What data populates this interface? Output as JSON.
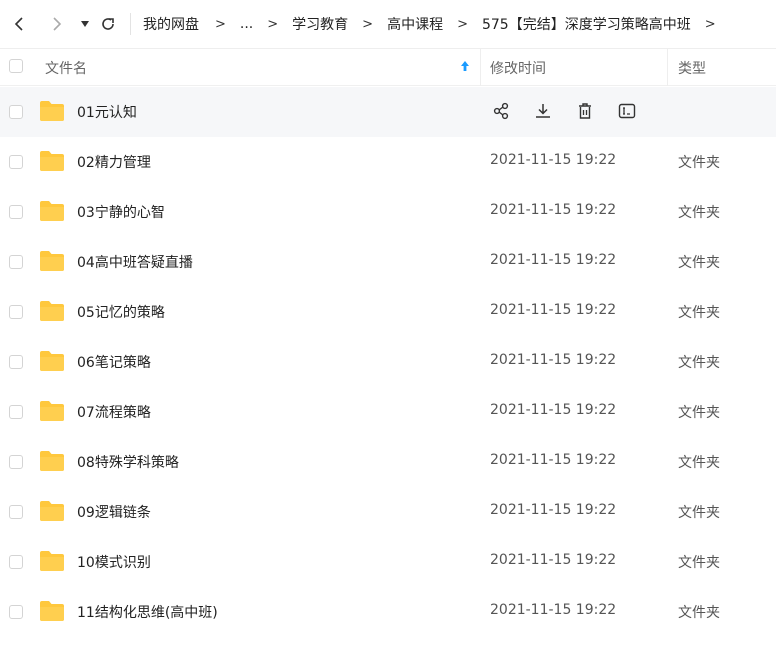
{
  "breadcrumb": [
    "我的网盘",
    "...",
    "学习教育",
    "高中课程",
    "575【完结】深度学习策略高中班"
  ],
  "header": {
    "name": "文件名",
    "modified": "修改时间",
    "type": "类型"
  },
  "rows": [
    {
      "name": "01元认知",
      "time": "",
      "type": ""
    },
    {
      "name": "02精力管理",
      "time": "2021-11-15 19:22",
      "type": "文件夹"
    },
    {
      "name": "03宁静的心智",
      "time": "2021-11-15 19:22",
      "type": "文件夹"
    },
    {
      "name": "04高中班答疑直播",
      "time": "2021-11-15 19:22",
      "type": "文件夹"
    },
    {
      "name": "05记忆的策略",
      "time": "2021-11-15 19:22",
      "type": "文件夹"
    },
    {
      "name": "06笔记策略",
      "time": "2021-11-15 19:22",
      "type": "文件夹"
    },
    {
      "name": "07流程策略",
      "time": "2021-11-15 19:22",
      "type": "文件夹"
    },
    {
      "name": "08特殊学科策略",
      "time": "2021-11-15 19:22",
      "type": "文件夹"
    },
    {
      "name": "09逻辑链条",
      "time": "2021-11-15 19:22",
      "type": "文件夹"
    },
    {
      "name": "10模式识别",
      "time": "2021-11-15 19:22",
      "type": "文件夹"
    },
    {
      "name": "11结构化思维(高中班)",
      "time": "2021-11-15 19:22",
      "type": "文件夹"
    }
  ],
  "colors": {
    "folder": "#ffc83d",
    "sort_arrow": "#1a9bff"
  },
  "icons": {
    "row_actions": [
      "share-icon",
      "download-icon",
      "delete-icon",
      "rename-icon"
    ],
    "nav": [
      "back-icon",
      "forward-icon",
      "history-dropdown-icon",
      "refresh-icon"
    ]
  }
}
